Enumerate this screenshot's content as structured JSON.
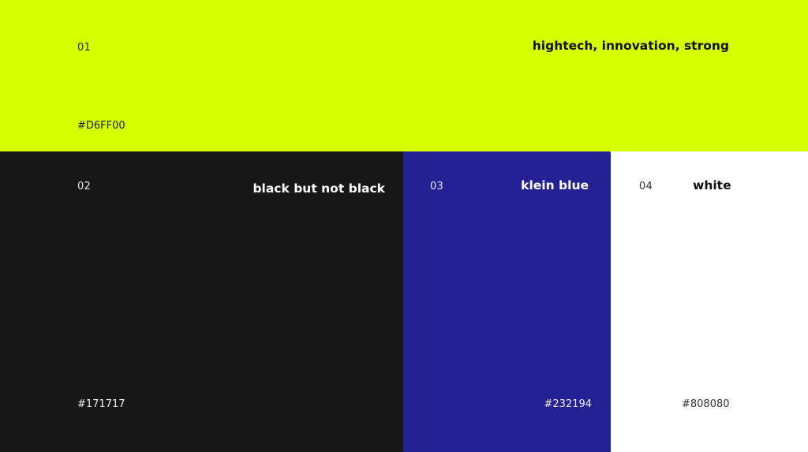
{
  "swatches": [
    {
      "number": "01",
      "label": "hightech, innovation, strong",
      "hex": "#D6FF00",
      "color": "#D6FF00"
    },
    {
      "number": "02",
      "label": "black but not black",
      "hex": "#171717",
      "color": "#171717"
    },
    {
      "number": "03",
      "label": "klein blue",
      "hex": "#232194",
      "color": "#232194"
    },
    {
      "number": "04",
      "label": "white",
      "hex": "#808080",
      "color": "#FFFFFF"
    }
  ]
}
